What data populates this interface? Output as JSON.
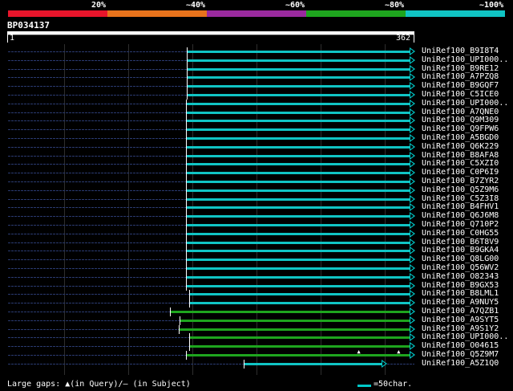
{
  "legend": {
    "labels": [
      "20%",
      "~40%",
      "~60%",
      "~80%",
      "~100%"
    ],
    "colors": [
      "#e8152b",
      "#e8731c",
      "#9a2a9e",
      "#1ea51e",
      "#10c4c4"
    ]
  },
  "query": {
    "name": "BP034137",
    "start": "1",
    "end": "362"
  },
  "hits": [
    {
      "label": "UniRef100_B9I8T4",
      "start": 1,
      "end": 362,
      "color": "#10c4c4",
      "pos": 0.44
    },
    {
      "label": "UniRef100_UPI000..",
      "start": 1,
      "end": 362,
      "color": "#10c4c4",
      "pos": 0.44
    },
    {
      "label": "UniRef100_B9RE12",
      "start": 1,
      "end": 362,
      "color": "#10c4c4",
      "pos": 0.44
    },
    {
      "label": "UniRef100_A7PZQ8",
      "start": 1,
      "end": 362,
      "color": "#10c4c4",
      "pos": 0.44
    },
    {
      "label": "UniRef100_B9GQF7",
      "start": 1,
      "end": 362,
      "color": "#10c4c4",
      "pos": 0.44
    },
    {
      "label": "UniRef100_C5ICE0",
      "start": 1,
      "end": 362,
      "color": "#10c4c4",
      "pos": 0.44
    },
    {
      "label": "UniRef100_UPI000..",
      "start": 1,
      "end": 362,
      "color": "#10c4c4",
      "pos": 0.437
    },
    {
      "label": "UniRef100_A7QNE0",
      "start": 1,
      "end": 362,
      "color": "#10c4c4",
      "pos": 0.437
    },
    {
      "label": "UniRef100_Q9M309",
      "start": 1,
      "end": 362,
      "color": "#10c4c4",
      "pos": 0.437
    },
    {
      "label": "UniRef100_Q9FPW6",
      "start": 1,
      "end": 362,
      "color": "#10c4c4",
      "pos": 0.437
    },
    {
      "label": "UniRef100_A5BGD0",
      "start": 1,
      "end": 362,
      "color": "#10c4c4",
      "pos": 0.437
    },
    {
      "label": "UniRef100_Q6K229",
      "start": 1,
      "end": 362,
      "color": "#10c4c4",
      "pos": 0.437
    },
    {
      "label": "UniRef100_B8AFA8",
      "start": 1,
      "end": 362,
      "color": "#10c4c4",
      "pos": 0.437
    },
    {
      "label": "UniRef100_C5XZI0",
      "start": 1,
      "end": 362,
      "color": "#10c4c4",
      "pos": 0.437
    },
    {
      "label": "UniRef100_C0P6I9",
      "start": 1,
      "end": 362,
      "color": "#10c4c4",
      "pos": 0.437
    },
    {
      "label": "UniRef100_B7ZYR2",
      "start": 1,
      "end": 362,
      "color": "#10c4c4",
      "pos": 0.437
    },
    {
      "label": "UniRef100_Q5Z9M6",
      "start": 1,
      "end": 362,
      "color": "#10c4c4",
      "pos": 0.437
    },
    {
      "label": "UniRef100_C5Z3I8",
      "start": 1,
      "end": 362,
      "color": "#10c4c4",
      "pos": 0.437
    },
    {
      "label": "UniRef100_B4FHV1",
      "start": 1,
      "end": 362,
      "color": "#10c4c4",
      "pos": 0.437
    },
    {
      "label": "UniRef100_Q6J6M8",
      "start": 1,
      "end": 362,
      "color": "#10c4c4",
      "pos": 0.437
    },
    {
      "label": "UniRef100_Q710P2",
      "start": 1,
      "end": 362,
      "color": "#10c4c4",
      "pos": 0.437
    },
    {
      "label": "UniRef100_C0HG55",
      "start": 1,
      "end": 362,
      "color": "#10c4c4",
      "pos": 0.437
    },
    {
      "label": "UniRef100_B6T8V9",
      "start": 1,
      "end": 362,
      "color": "#10c4c4",
      "pos": 0.437
    },
    {
      "label": "UniRef100_B9GKA4",
      "start": 1,
      "end": 362,
      "color": "#10c4c4",
      "pos": 0.437
    },
    {
      "label": "UniRef100_Q8LG00",
      "start": 1,
      "end": 362,
      "color": "#10c4c4",
      "pos": 0.437
    },
    {
      "label": "UniRef100_Q56WV2",
      "start": 1,
      "end": 362,
      "color": "#10c4c4",
      "pos": 0.437
    },
    {
      "label": "UniRef100_O82343",
      "start": 1,
      "end": 362,
      "color": "#10c4c4",
      "pos": 0.437
    },
    {
      "label": "UniRef100_B9GX53",
      "start": 1,
      "end": 362,
      "color": "#10c4c4",
      "pos": 0.437
    },
    {
      "label": "UniRef100_B8LML1",
      "start": 1,
      "end": 362,
      "color": "#10c4c4",
      "pos": 0.445
    },
    {
      "label": "UniRef100_A9NUY5",
      "start": 1,
      "end": 362,
      "color": "#10c4c4",
      "pos": 0.445
    },
    {
      "label": "UniRef100_A7QZB1",
      "start": 1,
      "end": 362,
      "color": "#1ea51e",
      "pos": 0.398
    },
    {
      "label": "UniRef100_A9SYT5",
      "start": 1,
      "end": 362,
      "color": "#1ea51e",
      "pos": 0.422
    },
    {
      "label": "UniRef100_A9S1Y2",
      "start": 1,
      "end": 362,
      "color": "#1ea51e",
      "pos": 0.42
    },
    {
      "label": "UniRef100_UPI000..",
      "start": 1,
      "end": 362,
      "color": "#1ea51e",
      "pos": 0.445
    },
    {
      "label": "UniRef100_O04615",
      "start": 1,
      "end": 362,
      "color": "#1ea51e",
      "pos": 0.445
    },
    {
      "label": "UniRef100_Q5Z9M7",
      "start": 1,
      "end": 362,
      "color": "#1ea51e",
      "pos": 0.437,
      "gaps": [
        0.865,
        0.963
      ]
    },
    {
      "label": "UniRef100_A5Z1Q0",
      "start": 1,
      "end": 362,
      "color": "#10c4c4",
      "pos": 0.58,
      "endPos": 0.92
    }
  ],
  "footer": {
    "gaps_text": "Large gaps: ▲(in Query)/– (in Subject)",
    "scale_text": "=50char."
  }
}
